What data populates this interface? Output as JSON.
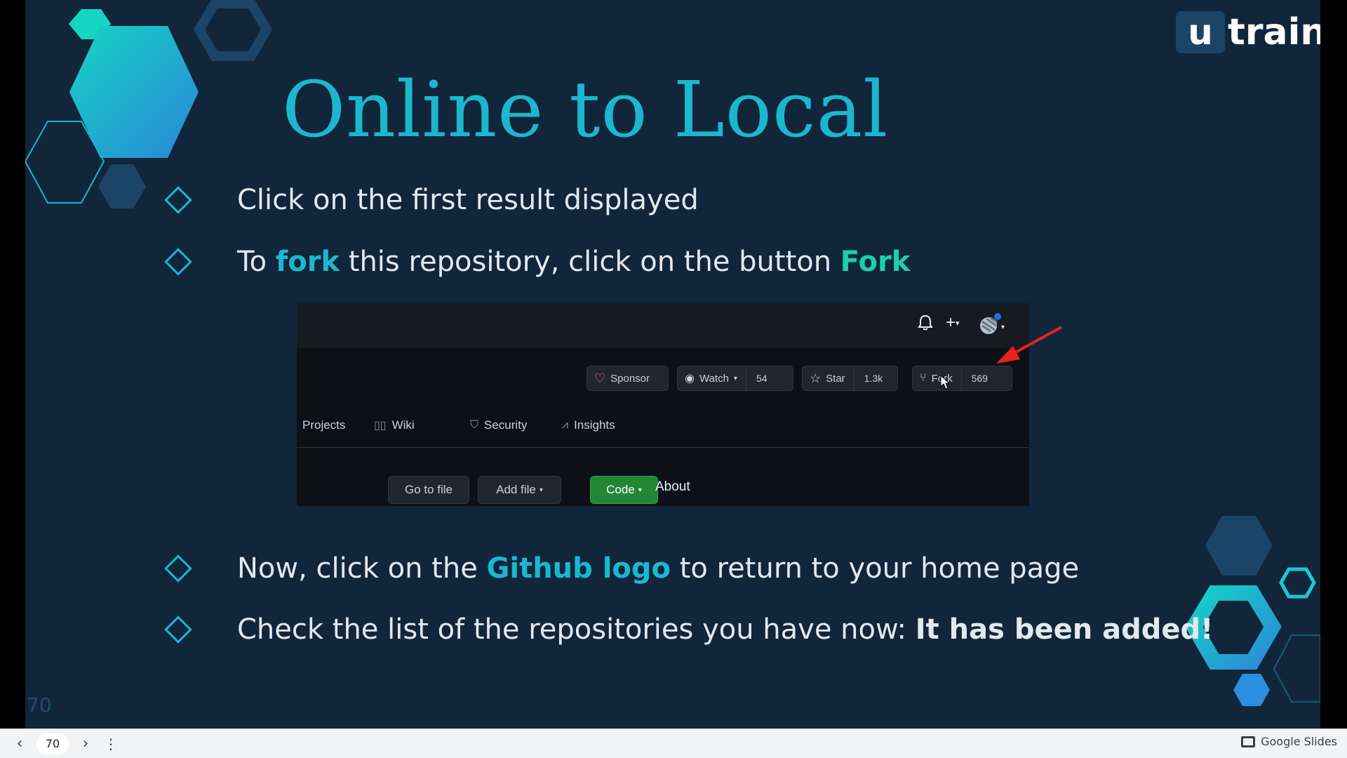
{
  "slide": {
    "title": "Online to Local",
    "logo": {
      "mark": "u",
      "word": "train"
    },
    "page_number": "70",
    "bullets": [
      {
        "text_a": "Click on the first result displayed"
      },
      {
        "text_a": "To ",
        "accent_a": "fork",
        "text_b": " this repository, click on the button ",
        "accent_b": "Fork"
      },
      {
        "text_a": "Now, click on the ",
        "accent_a": "Github logo",
        "text_b": " to return to your home page"
      },
      {
        "text_a": "Check the list of the repositories you have now: ",
        "strong": "It has been added!"
      }
    ],
    "colors": {
      "background": "#11263b",
      "accent": "#1cb7cf",
      "text": "#e3e8ee"
    }
  },
  "github_screenshot": {
    "header_icons": [
      "bell-icon",
      "plus-icon",
      "avatar"
    ],
    "sponsor": {
      "label": "Sponsor",
      "icon": "heart-icon"
    },
    "watch": {
      "label": "Watch",
      "count": "54",
      "icon": "eye-icon"
    },
    "star": {
      "label": "Star",
      "count": "1.3k",
      "icon": "star-icon"
    },
    "fork": {
      "label": "Fork",
      "count": "569",
      "icon": "fork-icon"
    },
    "tabs": [
      {
        "label": "Projects",
        "icon": ""
      },
      {
        "label": "Wiki",
        "icon": "book-icon"
      },
      {
        "label": "Security",
        "icon": "shield-icon"
      },
      {
        "label": "Insights",
        "icon": "graph-icon"
      }
    ],
    "actions": {
      "go_to_file": "Go to file",
      "add_file": "Add file",
      "code": "Code"
    },
    "about": "About"
  },
  "toolbar": {
    "current_page": "70",
    "brand": "Google Slides"
  }
}
